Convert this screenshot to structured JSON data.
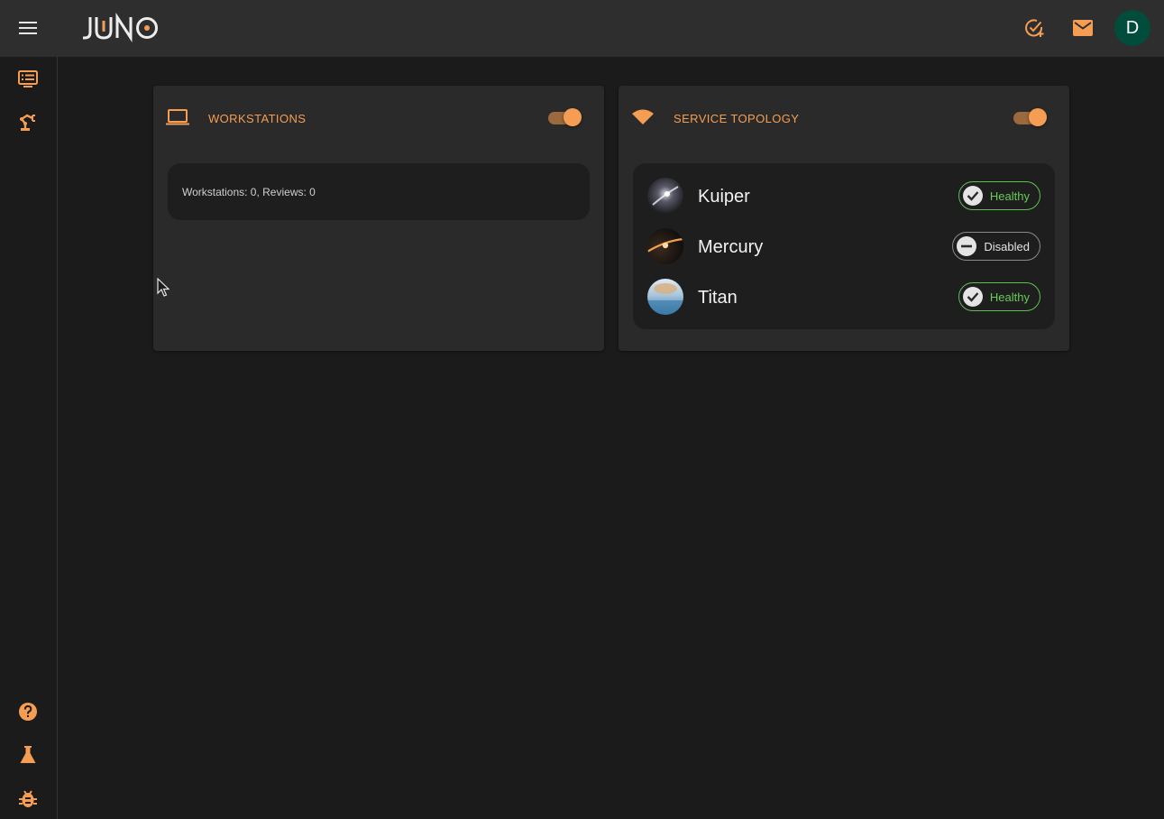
{
  "app": {
    "logo_text": "JUNO"
  },
  "header": {
    "menu_icon": "menu-icon",
    "actions": [
      {
        "name": "task-add-icon"
      },
      {
        "name": "mail-icon"
      }
    ],
    "avatar_letter": "D"
  },
  "sidebar": {
    "top_items": [
      "list-icon",
      "robot-arm-icon"
    ],
    "bottom_items": [
      "help-icon",
      "flask-icon",
      "bug-icon"
    ]
  },
  "cards": {
    "workstations": {
      "title": "WORKSTATIONS",
      "icon": "laptop-icon",
      "toggle_on": true,
      "summary": "Workstations: 0, Reviews: 0"
    },
    "topology": {
      "title": "SERVICE TOPOLOGY",
      "icon": "wifi-icon",
      "toggle_on": true,
      "services": [
        {
          "name": "Kuiper",
          "status": "Healthy"
        },
        {
          "name": "Mercury",
          "status": "Disabled"
        },
        {
          "name": "Titan",
          "status": "Healthy"
        }
      ]
    }
  },
  "colors": {
    "accent": "#f59e53",
    "healthy": "#66cc55",
    "avatar_bg": "#024c3c"
  }
}
